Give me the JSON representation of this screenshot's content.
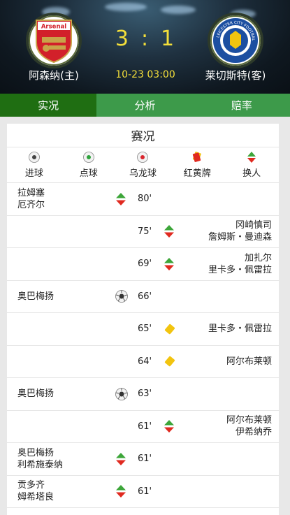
{
  "header": {
    "home_team": "阿森纳(主)",
    "away_team": "莱切斯特(客)",
    "home_score": "3",
    "score_sep": ":",
    "away_score": "1",
    "match_time": "10-23 03:00",
    "home_logo_text": "Arsenal",
    "away_logo_text": "LEICESTER CITY FOOTBALL CLUB"
  },
  "tabs": [
    {
      "label": "实况",
      "active": true
    },
    {
      "label": "分析",
      "active": false
    },
    {
      "label": "赔率",
      "active": false
    }
  ],
  "panel": {
    "title": "赛况",
    "legend": [
      {
        "label": "进球",
        "icon": "goal-ball-icon"
      },
      {
        "label": "点球",
        "icon": "penalty-ball-icon"
      },
      {
        "label": "乌龙球",
        "icon": "own-goal-ball-icon"
      },
      {
        "label": "红黄牌",
        "icon": "red-yellow-card-icon"
      },
      {
        "label": "换人",
        "icon": "substitution-icon"
      }
    ]
  },
  "events": [
    {
      "side": "home",
      "type": "substitution",
      "minute": "80'",
      "line1": "拉姆塞",
      "line2": "厄齐尔"
    },
    {
      "side": "away",
      "type": "substitution",
      "minute": "75'",
      "line1": "冈崎慎司",
      "line2": "詹姆斯・曼迪森"
    },
    {
      "side": "away",
      "type": "substitution",
      "minute": "69'",
      "line1": "加扎尔",
      "line2": "里卡多・佩雷拉"
    },
    {
      "side": "home",
      "type": "goal",
      "minute": "66'",
      "line1": "奥巴梅扬",
      "line2": ""
    },
    {
      "side": "away",
      "type": "yellow",
      "minute": "65'",
      "line1": "里卡多・佩雷拉",
      "line2": ""
    },
    {
      "side": "away",
      "type": "yellow",
      "minute": "64'",
      "line1": "阿尔布莱顿",
      "line2": ""
    },
    {
      "side": "home",
      "type": "goal",
      "minute": "63'",
      "line1": "奥巴梅扬",
      "line2": ""
    },
    {
      "side": "away",
      "type": "substitution",
      "minute": "61'",
      "line1": "阿尔布莱顿",
      "line2": "伊希纳乔"
    },
    {
      "side": "home",
      "type": "substitution",
      "minute": "61'",
      "line1": "奥巴梅扬",
      "line2": "利希施泰纳"
    },
    {
      "side": "home",
      "type": "substitution",
      "minute": "61'",
      "line1": "贡多齐",
      "line2": "姆希塔良"
    }
  ],
  "colors": {
    "tab_active": "#1f6e12",
    "tab_inactive": "#3d9a4a",
    "score_yellow": "#f4df3a"
  }
}
